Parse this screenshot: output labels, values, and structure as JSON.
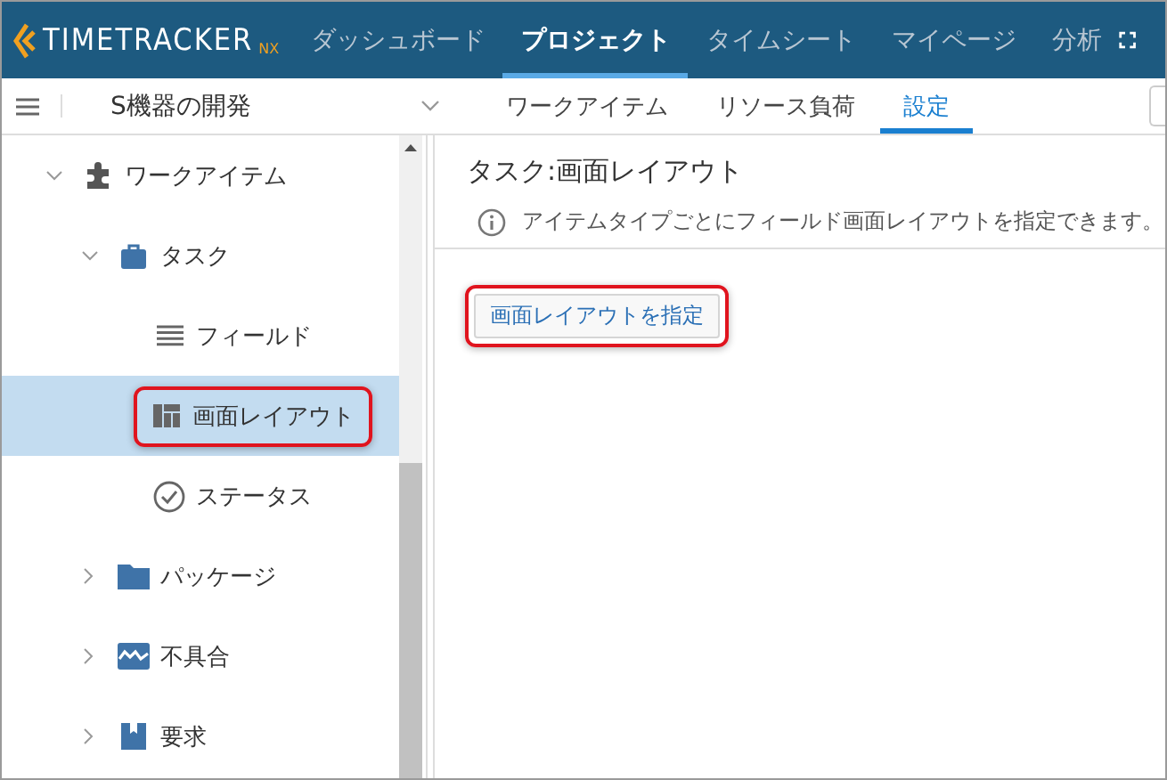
{
  "header": {
    "logo": "TIMETRACKER",
    "logo_suffix": "NX",
    "nav": [
      {
        "label": "ダッシュボード",
        "selected": false
      },
      {
        "label": "プロジェクト",
        "selected": true
      },
      {
        "label": "タイムシート",
        "selected": false
      },
      {
        "label": "マイページ",
        "selected": false
      },
      {
        "label": "分析",
        "selected": false
      }
    ]
  },
  "subbar": {
    "project": "S機器の開発",
    "tabs": [
      {
        "label": "ワークアイテム",
        "selected": false
      },
      {
        "label": "リソース負荷",
        "selected": false
      },
      {
        "label": "設定",
        "selected": true
      }
    ]
  },
  "tree": [
    {
      "label": "ワークアイテム",
      "expanded": true,
      "selected": false,
      "highlighted": false,
      "children": [
        {
          "label": "タスク",
          "expanded": true,
          "selected": false,
          "highlighted": false,
          "children": [
            {
              "label": "フィールド",
              "selected": false,
              "highlighted": false
            },
            {
              "label": "画面レイアウト",
              "selected": true,
              "highlighted": true
            },
            {
              "label": "ステータス",
              "selected": false,
              "highlighted": false
            }
          ]
        },
        {
          "label": "パッケージ",
          "expanded": false,
          "selected": false,
          "highlighted": false
        },
        {
          "label": "不具合",
          "expanded": false,
          "selected": false,
          "highlighted": false
        },
        {
          "label": "要求",
          "expanded": false,
          "selected": false,
          "highlighted": false
        }
      ]
    }
  ],
  "main": {
    "title": "タスク:画面レイアウト",
    "info": "アイテムタイプごとにフィールド画面レイアウトを指定できます。",
    "button": {
      "label": "画面レイアウトを指定",
      "highlighted": true
    }
  }
}
